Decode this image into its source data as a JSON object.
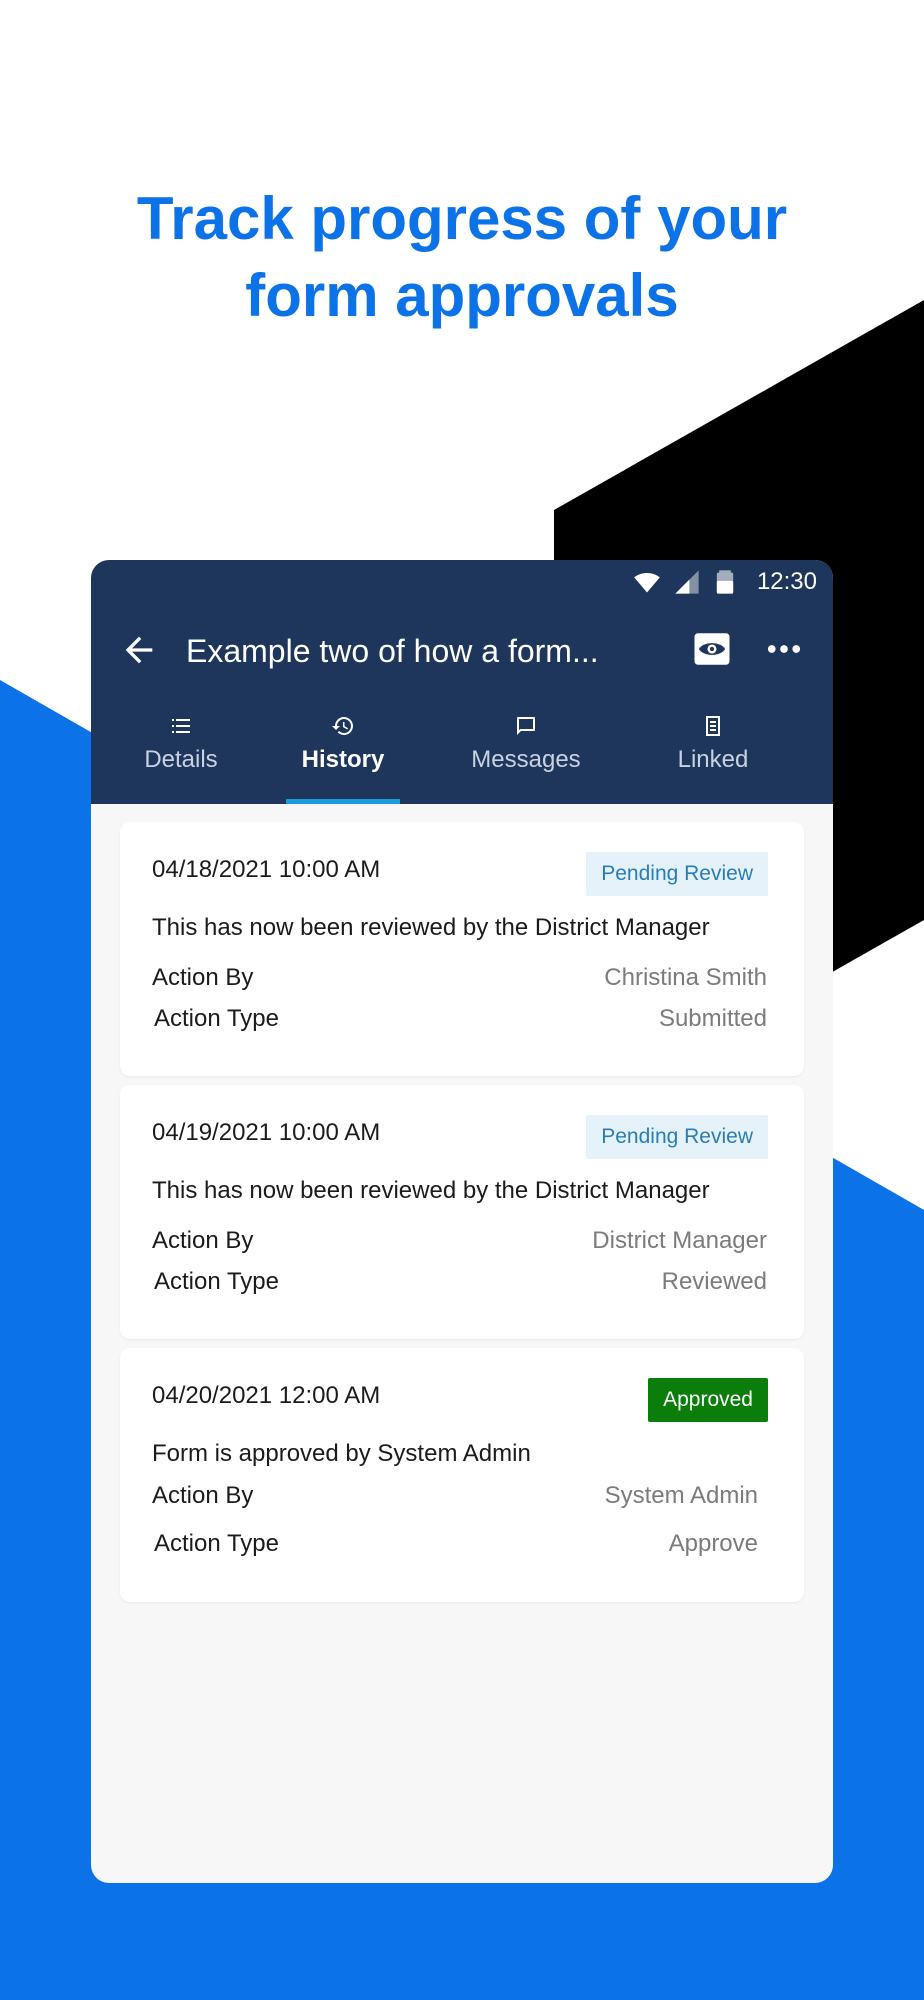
{
  "headline": {
    "line1": "Track progress of your",
    "line2": "form approvals"
  },
  "status_bar": {
    "time": "12:30"
  },
  "toolbar": {
    "title": "Example two of how a form..."
  },
  "tabs": [
    {
      "label": "Details",
      "icon": "list-icon"
    },
    {
      "label": "History",
      "icon": "history-icon",
      "active": true
    },
    {
      "label": "Messages",
      "icon": "message-icon"
    },
    {
      "label": "Linked",
      "icon": "document-icon"
    }
  ],
  "history": [
    {
      "date": "04/18/2021 10:00 AM",
      "status": "Pending Review",
      "description": "This has now been reviewed by the District Manager",
      "action_by_label": "Action By",
      "action_by": "Christina Smith",
      "action_type_label": "Action Type",
      "action_type": "Submitted"
    },
    {
      "date": "04/19/2021 10:00 AM",
      "status": "Pending Review",
      "description": "This has now been reviewed by the District Manager",
      "action_by_label": "Action By",
      "action_by": "District Manager",
      "action_type_label": "Action Type",
      "action_type": "Reviewed"
    },
    {
      "date": "04/20/2021 12:00 AM",
      "status": "Approved",
      "description": "Form is approved by System Admin",
      "action_by_label": "Action By",
      "action_by": "System Admin",
      "action_type_label": "Action Type",
      "action_type": "Approve"
    }
  ],
  "colors": {
    "brand_blue": "#0b72e7",
    "appbar": "#1e355c",
    "tab_indicator": "#1a9bdc",
    "pending_badge_bg": "#e5f2f9",
    "pending_badge_text": "#2a7eb8",
    "approved_badge_bg": "#0a7d0a"
  }
}
